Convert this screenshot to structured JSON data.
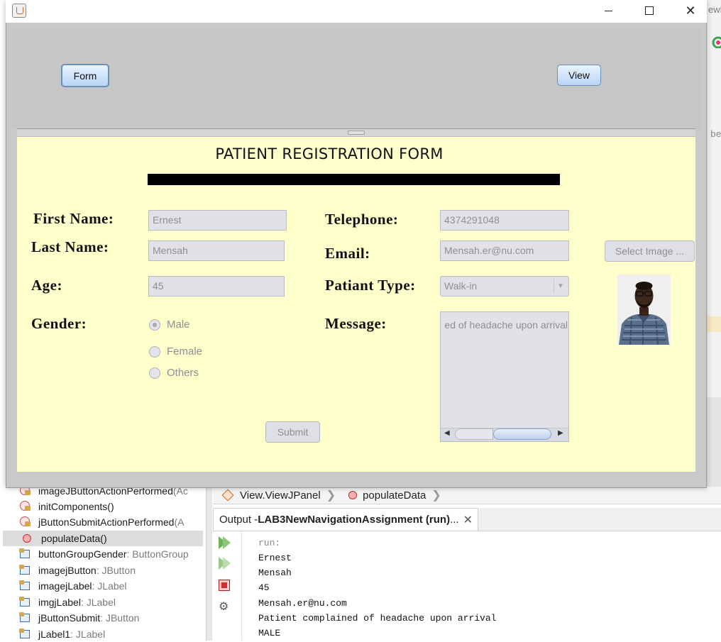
{
  "ide": {
    "navigator": {
      "items": [
        {
          "name": "imageJButtonActionPerformed",
          "type": "(Ac",
          "icon": "private-method-icon"
        },
        {
          "name": "initComponents()",
          "type": "",
          "icon": "private-method-icon"
        },
        {
          "name": "jButtonSubmitActionPerformed",
          "type": "(A",
          "icon": "private-method-icon"
        },
        {
          "name": "populateData()",
          "type": "",
          "icon": "method-icon"
        },
        {
          "name": "buttonGroupGender",
          "type": " : ButtonGroup",
          "icon": "field-icon"
        },
        {
          "name": "imagejButton",
          "type": " : JButton",
          "icon": "field-icon"
        },
        {
          "name": "imagejLabel",
          "type": " : JLabel",
          "icon": "field-icon"
        },
        {
          "name": "imgjLabel",
          "type": " : JLabel",
          "icon": "field-icon"
        },
        {
          "name": "jButtonSubmit",
          "type": " : JButton",
          "icon": "field-icon"
        },
        {
          "name": "jLabel1",
          "type": " : JLabel",
          "icon": "field-icon"
        }
      ]
    },
    "breadcrumb": [
      "View.ViewJPanel",
      "populateData"
    ],
    "output": {
      "tab_prefix": "Output - ",
      "tab_title": "LAB3NewNavigationAssignment (run)",
      "tab_ellipsis": " ...",
      "lines": [
        "run:",
        "Ernest",
        "Mensah",
        "45",
        "Mensah.er@nu.com",
        "Patient complained of headache upon arrival",
        "MALE"
      ]
    },
    "edge_text_top": "ewN",
    "edge_text_mid": "be"
  },
  "window": {
    "controls": {
      "minimize": "minimize-icon",
      "maximize": "maximize-icon",
      "close": "close-icon"
    }
  },
  "nav_buttons": {
    "form": "Form",
    "view": "View"
  },
  "form": {
    "title": "PATIENT REGISTRATION FORM",
    "labels": {
      "first_name": "First Name:",
      "last_name": "Last Name:",
      "age": "Age:",
      "gender": "Gender:",
      "telephone": "Telephone:",
      "email": "Email:",
      "patient_type": "Patiant Type:",
      "message": "Message:"
    },
    "values": {
      "first_name": "Ernest",
      "last_name": "Mensah",
      "age": "45",
      "telephone": "4374291048",
      "email": "Mensah.er@nu.com",
      "patient_type": "Walk-in",
      "message": "ed of headache upon arrival"
    },
    "gender_options": [
      "Male",
      "Female",
      "Others"
    ],
    "gender_selected": "Male",
    "submit_label": "Submit",
    "select_image_label": "Select Image ..."
  },
  "colors": {
    "form_background": "#ffffcc",
    "panel_gray": "#c6c6c6",
    "disabled_text": "#8e8e96"
  }
}
